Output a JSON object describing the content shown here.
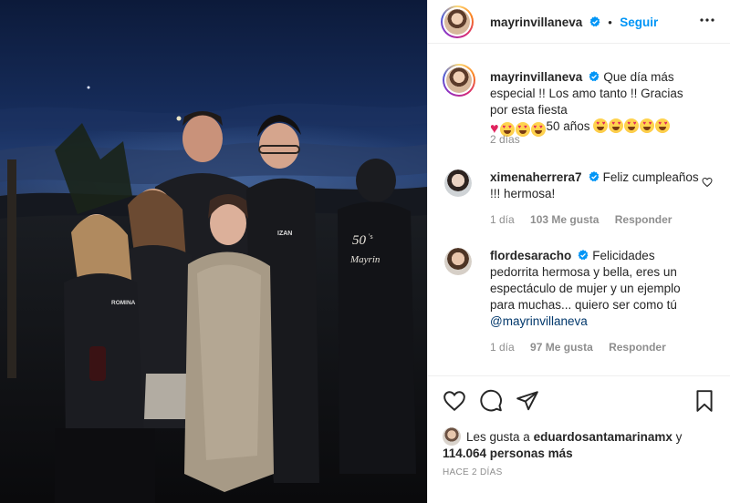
{
  "post": {
    "photo_alt": "",
    "header": {
      "username": "mayrinvillaneva",
      "verified_icon": "verified-badge-icon",
      "separator": "•",
      "follow_label": "Seguir",
      "more_icon": "more-options-icon"
    },
    "caption": {
      "username": "mayrinvillaneva",
      "text_part1": "Que día más especial !! Los amo tanto !! Gracias por esta fiesta",
      "text_part2": "50 años",
      "time": "2 días"
    },
    "comments": [
      {
        "username": "ximenaherrera7",
        "text": "Feliz cumpleaños !!! hermosa!",
        "time": "1 día",
        "likes": "103 Me gusta",
        "reply": "Responder"
      },
      {
        "username": "flordesaracho",
        "text": "Felicidades pedorrita hermosa y bella, eres un espectáculo de mujer y un ejemplo para muchas... quiero ser como tú",
        "mention": "@mayrinvillaneva",
        "time": "1 día",
        "likes": "97 Me gusta",
        "reply": "Responder"
      }
    ],
    "actions": {
      "like_icon": "heart-icon",
      "comment_icon": "comment-icon",
      "share_icon": "paper-plane-icon",
      "save_icon": "bookmark-icon"
    },
    "likes": {
      "prefix": "Les gusta a",
      "user": "eduardosantamarinamx",
      "joiner": "y",
      "count": "114.064 personas más"
    },
    "timestamp": "HACE 2 DÍAS"
  },
  "colors": {
    "link_blue": "#0095f6",
    "mention_blue": "#00376b",
    "muted": "#8e8e8e",
    "text": "#262626",
    "heart_red": "#e0245e"
  }
}
